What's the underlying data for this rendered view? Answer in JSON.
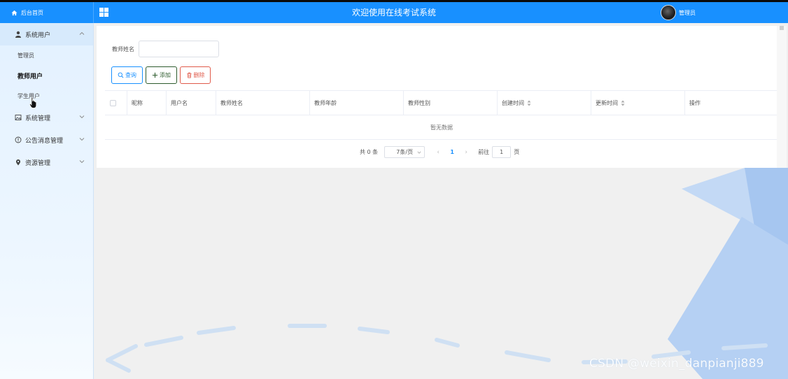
{
  "header": {
    "brand_label": "后台首页",
    "title": "欢迎使用在线考试系统",
    "user_name": "管理员"
  },
  "sidebar": {
    "groups": [
      {
        "label": "系统用户",
        "icon": "user-icon",
        "expanded": true,
        "items": [
          {
            "label": "管理员",
            "active": false
          },
          {
            "label": "教师用户",
            "active": true
          },
          {
            "label": "学生用户",
            "active": false
          }
        ]
      },
      {
        "label": "系统管理",
        "icon": "image-icon",
        "expanded": false
      },
      {
        "label": "公告消息管理",
        "icon": "info-circle-icon",
        "expanded": false
      },
      {
        "label": "资源管理",
        "icon": "location-pin-icon",
        "expanded": false
      }
    ]
  },
  "filter": {
    "teacher_name_label": "教师姓名",
    "teacher_name_value": ""
  },
  "toolbar": {
    "query_label": "查询",
    "add_label": "添加",
    "delete_label": "删除"
  },
  "table": {
    "columns": [
      "",
      "昵称",
      "用户名",
      "教师姓名",
      "教师年龄",
      "教师性别",
      "创建时间",
      "更新时间",
      "操作"
    ],
    "rows": [],
    "empty_text": "暂无数据"
  },
  "pagination": {
    "total_text": "共 0 条",
    "page_size": "7条/页",
    "current_page": "1",
    "goto_label": "前往",
    "goto_value": "1",
    "page_suffix": "页"
  },
  "watermark": "CSDN @weixin_danpianji889",
  "colors": {
    "primary": "#1890ff",
    "add": "#2e5c2e",
    "delete": "#e05a4a",
    "sidebar_bg": "#e3f1ff"
  }
}
